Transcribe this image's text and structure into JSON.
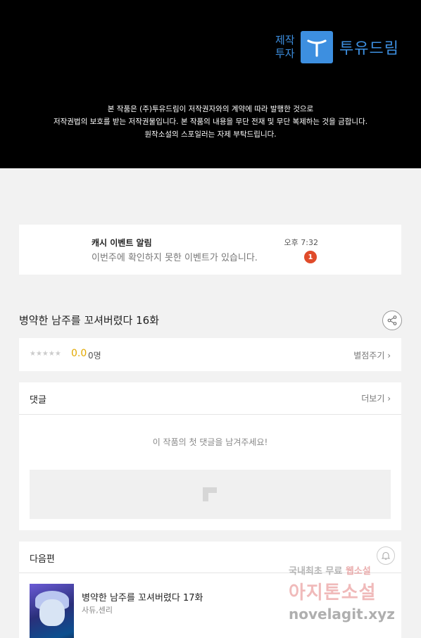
{
  "header": {
    "brand_small_line1": "제작",
    "brand_small_line2": "투자",
    "brand_name": "투유드림",
    "notice_lines": [
      "본 작품은 (주)투유드림이 저작권자와의 계약에 따라 발행한 것으로",
      "저작권법의 보호를 받는 저작권물입니다. 본 작품의 내용을 무단 전재 및 무단 복제하는 것을 금합니다.",
      "원작소설의 스포일러는 자제 부탁드립니다."
    ],
    "brand_color": "#3d8fe0"
  },
  "notification": {
    "title": "캐시 이벤트 알림",
    "message": "이번주에 확인하지 못한 이벤트가 있습니다.",
    "time": "오후 7:32",
    "badge_count": "1"
  },
  "episode": {
    "title": "병약한 남주를 꼬셔버렸다 16화"
  },
  "rating": {
    "stars": "★★★★★",
    "score": "0.0",
    "count": "0명",
    "rate_link": "별점주기 ›"
  },
  "comments": {
    "title": "댓글",
    "more_link": "더보기 ›",
    "empty_message": "이 작품의 첫 댓글을 남겨주세요!"
  },
  "next_episode": {
    "section_title": "다음편",
    "title": "병약한 남주를 꼬셔버렸다 17화",
    "author": "사듀,센리"
  },
  "watermark": {
    "line1_a": "국내최초 무료",
    "line1_b": "웹소설",
    "line2": "아지톤소설",
    "line3": "novelagit.xyz"
  },
  "icons": {
    "share": "share-icon",
    "bell": "bell-icon",
    "comment_box": "image-placeholder-icon",
    "logo": "tudream-logo-icon"
  }
}
